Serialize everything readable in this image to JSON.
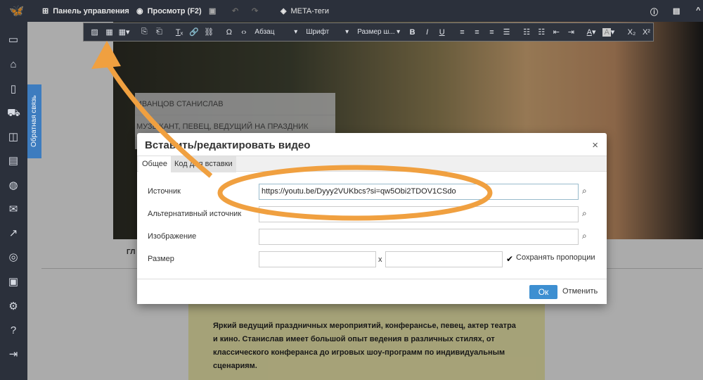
{
  "topbar": {
    "dashboard": "Панель управления",
    "preview": "Просмотр (F2)",
    "meta": "META-теги"
  },
  "toolbar": {
    "paragraph": "Абзац",
    "font": "Шрифт",
    "size": "Размер ш..."
  },
  "feedback": "Обратная связь",
  "page": {
    "card_name": "ИВАНЦОВ СТАНИСЛАВ",
    "card_role": "МУЗЫКАНТ, ПЕВЕЦ, ВЕДУЩИЙ НА ПРАЗДНИК",
    "nav_fragment": "ГЛ",
    "bio": "Яркий ведущий праздничных мероприятий, конферансье, певец, актер театра и кино. Станислав имеет большой опыт ведения в различных стилях, от классического конферанса до игровых шоу-программ по индивидуальным сценариям."
  },
  "dialog": {
    "title": "Вставить/редактировать видео",
    "close": "×",
    "tabs": [
      "Общее",
      "Код для вставки"
    ],
    "source_label": "Источник",
    "source_value": "https://youtu.be/Dyyy2VUKbcs?si=qw5Obi2TDOV1CSdo",
    "alt_label": "Альтернативный источник",
    "image_label": "Изображение",
    "size_label": "Размер",
    "size_x": "x",
    "keep_ratio": "Сохранять пропорции",
    "keep_ratio_checked": true,
    "ok": "Ок",
    "cancel": "Отменить"
  },
  "colors": {
    "annotation": "#f0a040",
    "accent": "#3d8fd1"
  }
}
